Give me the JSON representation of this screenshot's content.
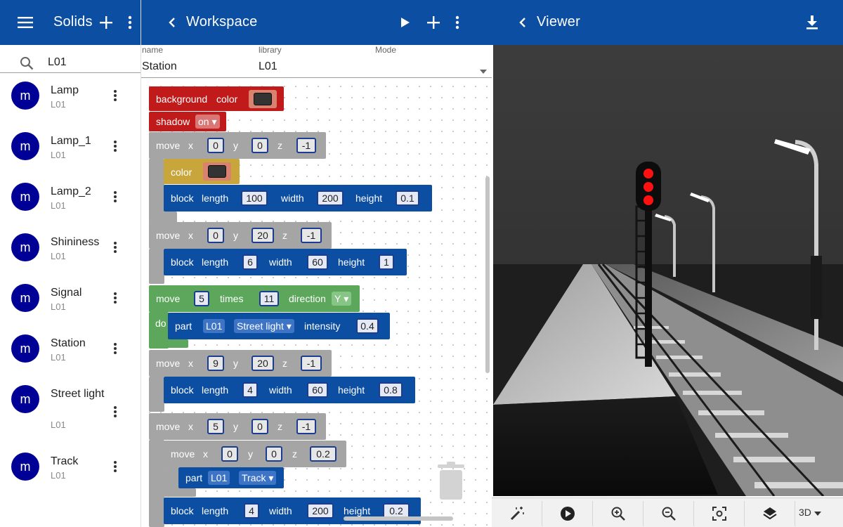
{
  "left": {
    "title": "Solids",
    "search": {
      "value": "L01",
      "icon": "search-icon"
    },
    "items": [
      {
        "name": "Lamp",
        "lib": "L01",
        "avatar": "m"
      },
      {
        "name": "Lamp_1",
        "lib": "L01",
        "avatar": "m"
      },
      {
        "name": "Lamp_2",
        "lib": "L01",
        "avatar": "m"
      },
      {
        "name": "Shininess",
        "lib": "L01",
        "avatar": "m"
      },
      {
        "name": "Signal",
        "lib": "L01",
        "avatar": "m"
      },
      {
        "name": "Station",
        "lib": "L01",
        "avatar": "m"
      },
      {
        "name": "Street light",
        "lib": "L01",
        "avatar": "m"
      },
      {
        "name": "Track",
        "lib": "L01",
        "avatar": "m"
      }
    ]
  },
  "mid": {
    "title": "Workspace",
    "fields": {
      "name_label": "name",
      "name_value": "Station",
      "library_label": "library",
      "library_value": "L01",
      "mode_label": "Mode",
      "mode_value": ""
    },
    "blocks": {
      "bg": {
        "kw1": "background",
        "kw2": "color"
      },
      "shadow": {
        "kw": "shadow",
        "value": "on"
      },
      "move1": {
        "kw": "move",
        "x": "x",
        "xv": "0",
        "y": "y",
        "yv": "0",
        "z": "z",
        "zv": "-1"
      },
      "color": {
        "kw": "color"
      },
      "block1": {
        "kw": "block",
        "l": "length",
        "lv": "100",
        "w": "width",
        "wv": "200",
        "h": "height",
        "hv": "0.1"
      },
      "move2": {
        "kw": "move",
        "x": "x",
        "xv": "0",
        "y": "y",
        "yv": "20",
        "z": "z",
        "zv": "-1"
      },
      "block2": {
        "kw": "block",
        "l": "length",
        "lv": "6",
        "w": "width",
        "wv": "60",
        "h": "height",
        "hv": "1"
      },
      "repeat": {
        "kw": "move",
        "times_v": "5",
        "times": "times",
        "step_v": "11",
        "dir": "direction",
        "dir_v": "Y",
        "do": "do"
      },
      "part1": {
        "kw": "part",
        "lib": "L01",
        "name": "Street light",
        "int": "intensity",
        "int_v": "0.4"
      },
      "move3": {
        "kw": "move",
        "x": "x",
        "xv": "9",
        "y": "y",
        "yv": "20",
        "z": "z",
        "zv": "-1"
      },
      "block3": {
        "kw": "block",
        "l": "length",
        "lv": "4",
        "w": "width",
        "wv": "60",
        "h": "height",
        "hv": "0.8"
      },
      "move4": {
        "kw": "move",
        "x": "x",
        "xv": "5",
        "y": "y",
        "yv": "0",
        "z": "z",
        "zv": "-1"
      },
      "move5": {
        "kw": "move",
        "x": "x",
        "xv": "0",
        "y": "y",
        "yv": "0",
        "z": "z",
        "zv": "0.2"
      },
      "part2": {
        "kw": "part",
        "lib": "L01",
        "name": "Track"
      },
      "block4": {
        "kw": "block",
        "l": "length",
        "lv": "4",
        "w": "width",
        "wv": "200",
        "h": "height",
        "hv": "0.2"
      }
    }
  },
  "right": {
    "title": "Viewer",
    "toolbar": {
      "mode": "3D",
      "icons": [
        "magic-wand-icon",
        "play-circle-icon",
        "zoom-in-icon",
        "zoom-out-icon",
        "center-focus-icon",
        "layers-icon"
      ]
    }
  }
}
